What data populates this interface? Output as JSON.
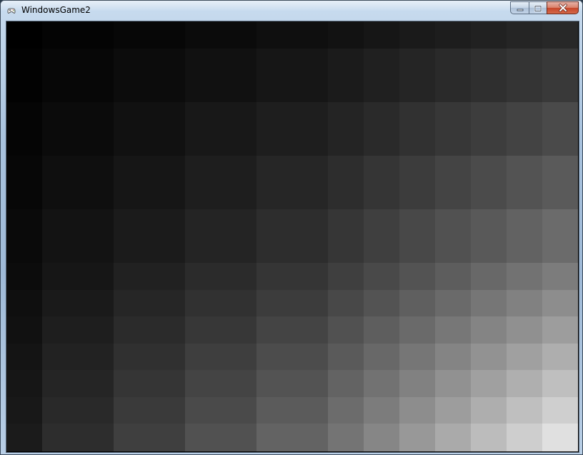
{
  "window": {
    "title": "WindowsGame2",
    "icon": "game-controller-icon",
    "controls": {
      "minimize_icon": "minimize-icon",
      "maximize_icon": "maximize-icon",
      "close_icon": "close-icon"
    }
  },
  "scene": {
    "description_type": "grayscale-gradient-tile-grid",
    "columns": 16,
    "rows": 12,
    "min_gray": 0,
    "max_gray": 224,
    "base_color": "#000000"
  }
}
